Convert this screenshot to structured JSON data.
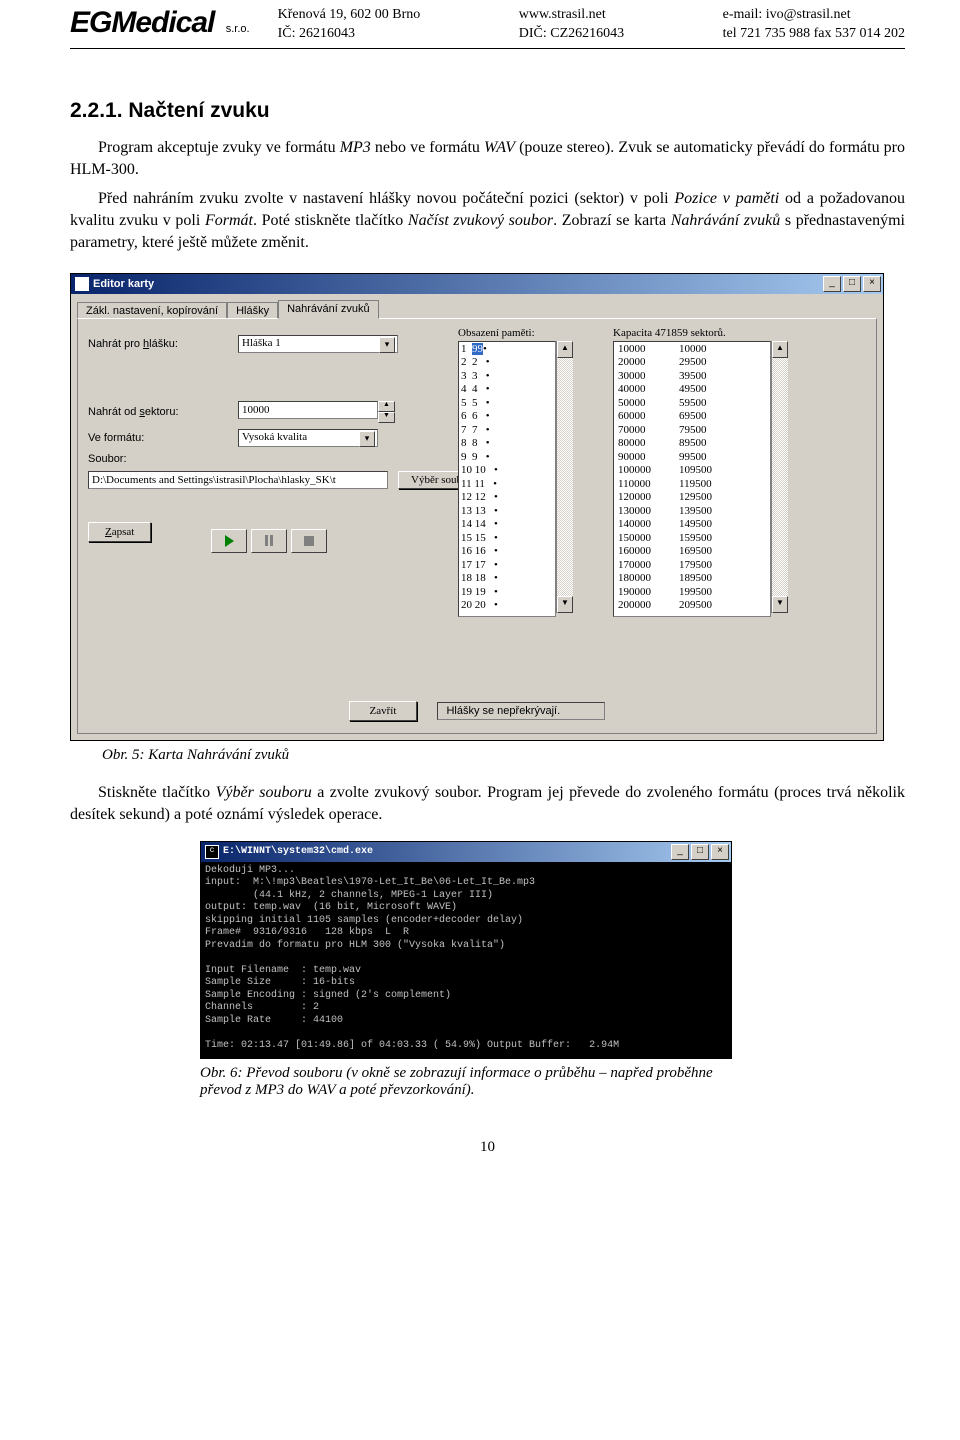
{
  "header": {
    "logo": "EGMedical",
    "logo_sub": "s.r.o.",
    "c1a": "Křenová 19, 602 00 Brno",
    "c1b": "IČ: 26216043",
    "c2a": "www.strasil.net",
    "c2b": "DIČ: CZ26216043",
    "c3a": "e-mail: ivo@strasil.net",
    "c3b": "tel 721 735 988        fax 537 014 202"
  },
  "section_heading": "2.2.1.  Načtení zvuku",
  "para1_a": "Program akceptuje zvuky ve formátu ",
  "para1_b": "MP3",
  "para1_c": "          nebo ve formátu ",
  "para1_d": "WAV",
  "para1_e": "          (pouze stereo). Zvuk se automaticky převádí do formátu pro HLM-300.",
  "para2_a": "Před nahráním zvuku zvolte v nastavení hlášky novou počáteční pozici (sektor) v poli ",
  "para2_b": "Pozice v paměti",
  "para2_c": " od a požadovanou kvalitu zvuku v poli ",
  "para2_d": "Formát",
  "para2_e": ". Poté stiskněte tlačítko ",
  "para2_f": "Načíst zvukový soubor",
  "para2_g": ". Zobrazí se karta ",
  "para2_h": "Nahrávání zvuků",
  "para2_i": " s přednastavenými parametry, které ještě můžete změnit.",
  "fig5": "Obr. 5: Karta Nahrávání zvuků",
  "para3_a": "Stiskněte tlačítko ",
  "para3_b": "Výběr souboru",
  "para3_c": " a zvolte zvukový soubor. Program jej převede do zvoleného formátu (proces trvá několik desítek sekund) a poté oznámí výsledek operace.",
  "fig6": "Obr. 6: Převod souboru (v okně se zobrazují informace o průběhu – napřed proběhne převod z MP3 do WAV a poté převzorkování).",
  "page_number": "10",
  "dlg": {
    "title": "Editor karty",
    "tabs": [
      "Zákl. nastavení, kopírování",
      "Hlášky",
      "Nahrávání zvuků"
    ],
    "lbl_nahrat": "Nahrát pro hlášku:",
    "combo_hlaska": "Hláška 1",
    "lbl_sektor": "Nahrát od sektoru:",
    "val_sektor": "10000",
    "lbl_format": "Ve formátu:",
    "combo_format": "Vysoká kvalita",
    "lbl_soubor": "Soubor:",
    "val_soubor": "D:\\Documents and Settings\\istrasil\\Plocha\\hlasky_SK\\t",
    "btn_vyber": "Výběr souboru",
    "btn_zapsat": "Zapsat",
    "btn_close": "Zavřít",
    "status": "Hlášky se nepřekrývají.",
    "mem_label": "Obsazení paměti:",
    "cap_label": "Kapacita 471859 sektorů.",
    "mem": [
      "1",
      "2",
      "3",
      "4",
      "5",
      "6",
      "7",
      "8",
      "9",
      "10",
      "11",
      "12",
      "13",
      "14",
      "15",
      "16",
      "17",
      "18",
      "19",
      "20"
    ],
    "memv": [
      "99",
      "2",
      "3",
      "4",
      "5",
      "6",
      "7",
      "8",
      "9",
      "10",
      "11",
      "12",
      "13",
      "14",
      "15",
      "16",
      "17",
      "18",
      "19",
      "20"
    ],
    "capA": [
      "10000",
      "20000",
      "30000",
      "40000",
      "50000",
      "60000",
      "70000",
      "80000",
      "90000",
      "100000",
      "110000",
      "120000",
      "130000",
      "140000",
      "150000",
      "160000",
      "170000",
      "180000",
      "190000",
      "200000"
    ],
    "capB": [
      "10000",
      "29500",
      "39500",
      "49500",
      "59500",
      "69500",
      "79500",
      "89500",
      "99500",
      "109500",
      "119500",
      "129500",
      "139500",
      "149500",
      "159500",
      "169500",
      "179500",
      "189500",
      "199500",
      "209500"
    ]
  },
  "cmd": {
    "title": "E:\\WINNT\\system32\\cmd.exe",
    "body": "Dekoduji MP3...\ninput:  M:\\!mp3\\Beatles\\1970-Let_It_Be\\06-Let_It_Be.mp3\n        (44.1 kHz, 2 channels, MPEG-1 Layer III)\noutput: temp.wav  (16 bit, Microsoft WAVE)\nskipping initial 1105 samples (encoder+decoder delay)\nFrame#  9316/9316   128 kbps  L  R\nPrevadim do formatu pro HLM 300 (\"Vysoka kvalita\")\n\nInput Filename  : temp.wav\nSample Size     : 16-bits\nSample Encoding : signed (2's complement)\nChannels        : 2\nSample Rate     : 44100\n\nTime: 02:13.47 [01:49.86] of 04:03.33 ( 54.9%) Output Buffer:   2.94M"
  }
}
